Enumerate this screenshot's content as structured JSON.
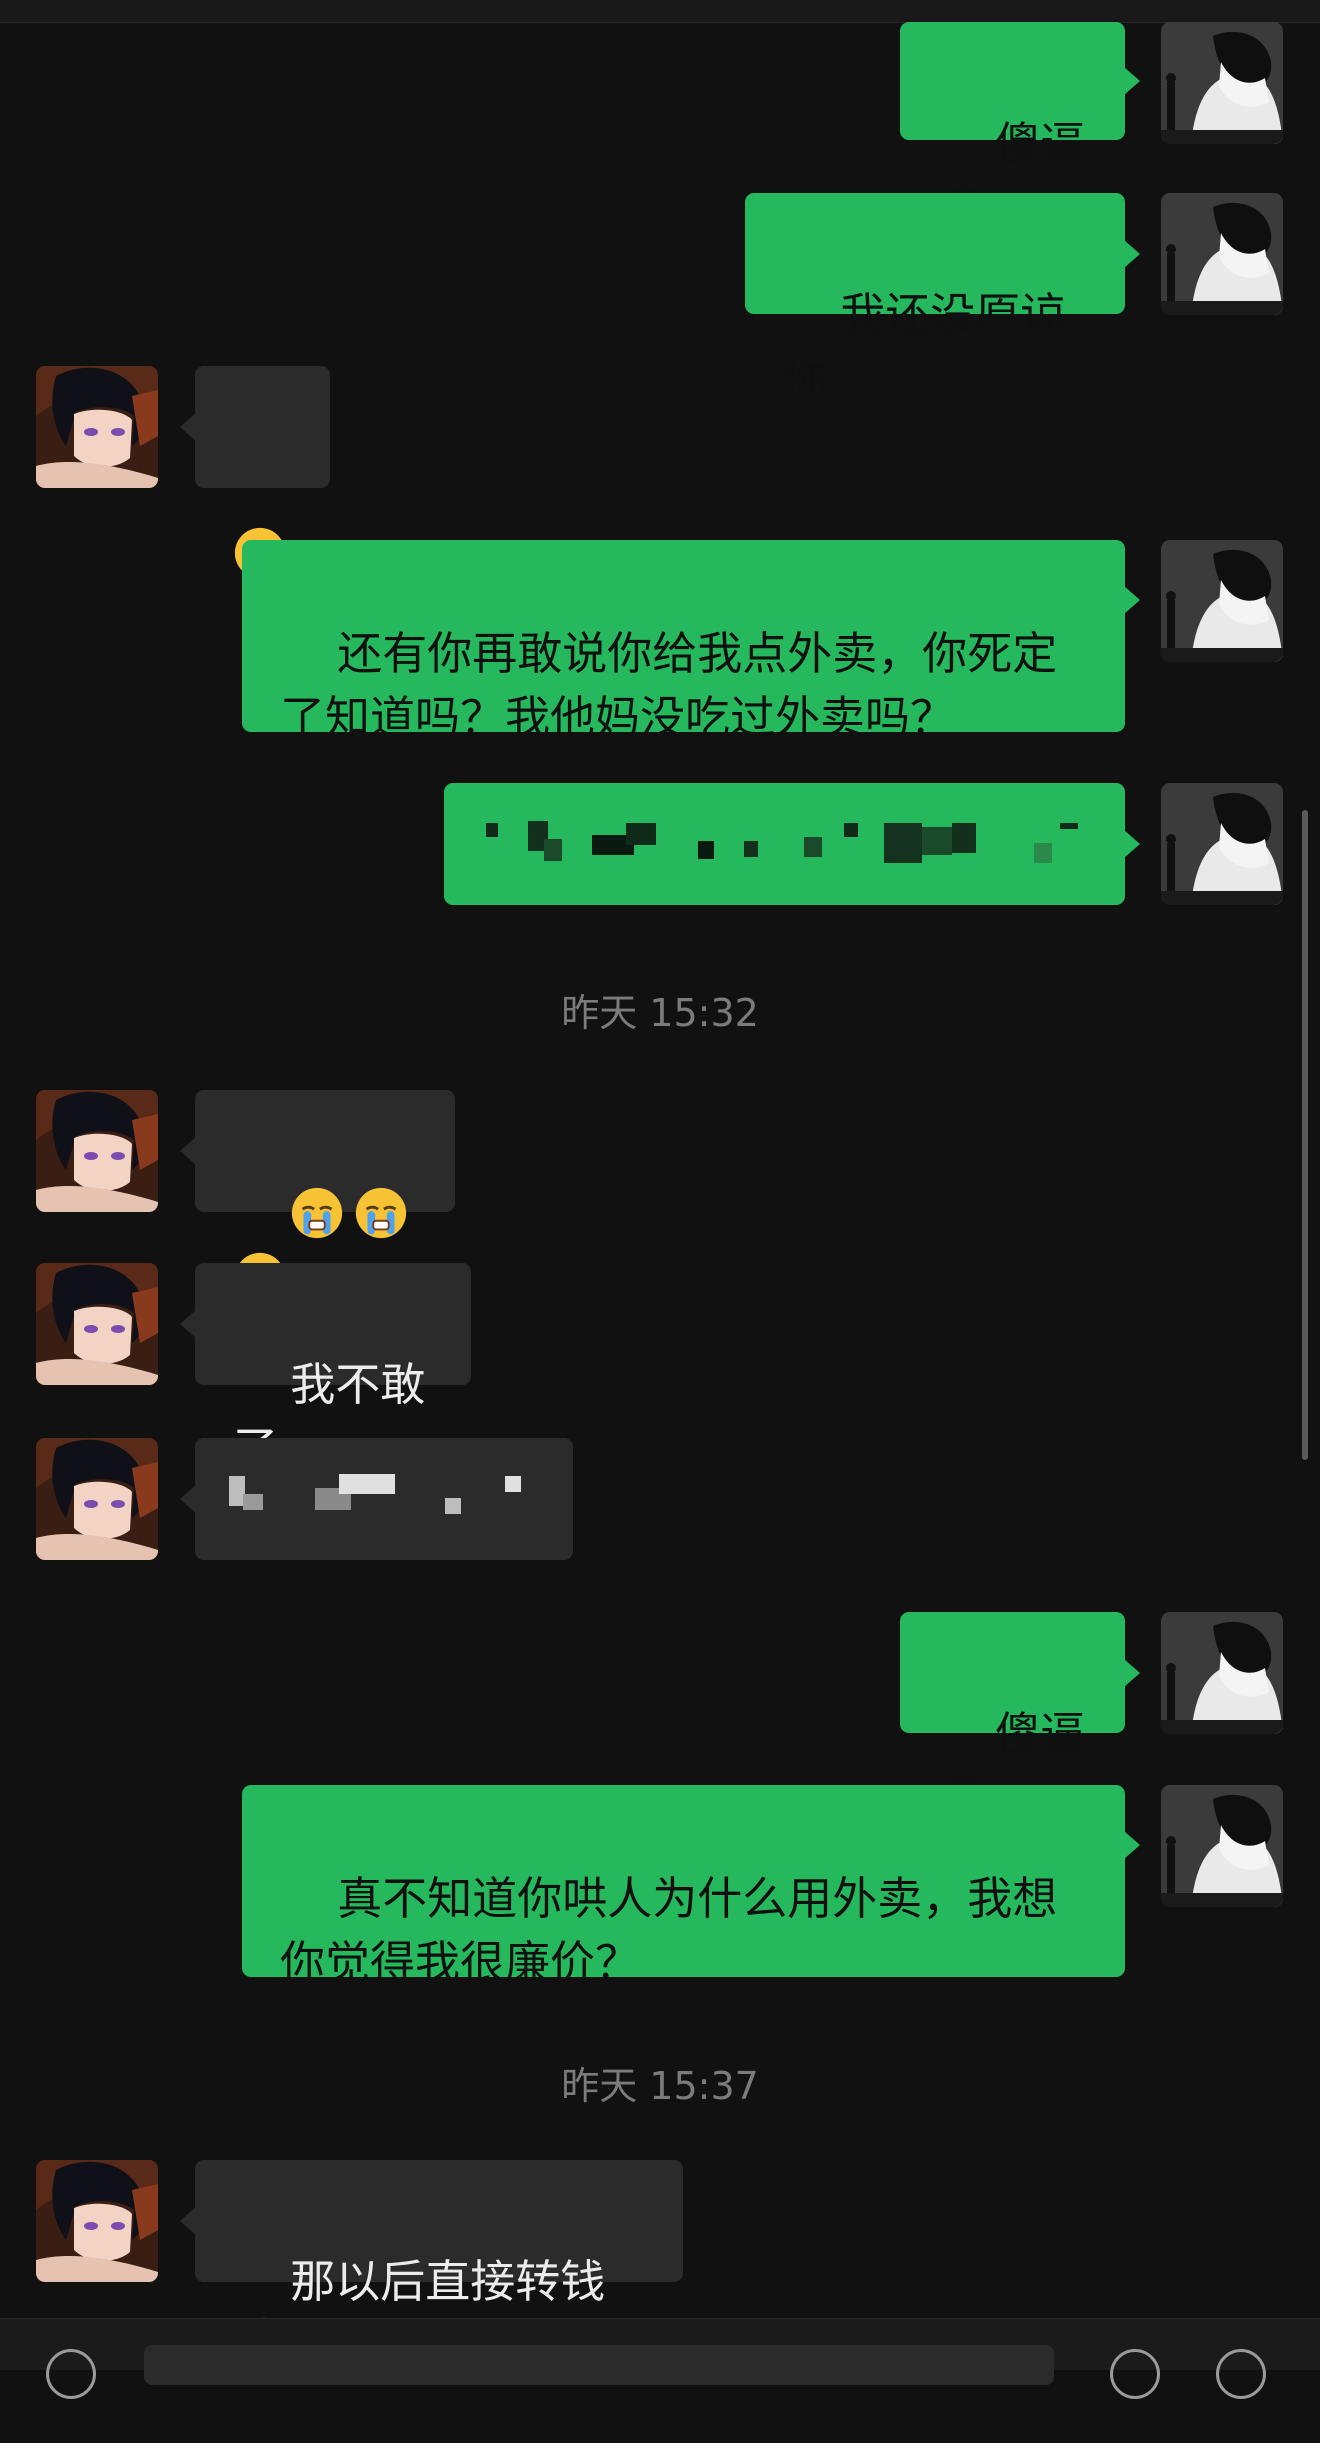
{
  "conversation": {
    "messages": [
      {
        "text": "傻逼滚"
      },
      {
        "text": "我还没原谅你"
      },
      {
        "text": "还有你再敢说你给我点外卖，你死定了知道吗？我他妈没吃过外卖吗？"
      },
      {
        "text": "我不敢了"
      },
      {
        "text": "傻逼滚"
      },
      {
        "text": "真不知道你哄人为什么用外卖，我想你觉得我很廉价？"
      },
      {
        "text": "那以后直接转钱"
      }
    ],
    "timestamps": [
      "昨天 15:32",
      "昨天 15:37"
    ]
  },
  "icons": {
    "emoji": "loudly-crying-face-emoji",
    "emoji_alt": "crying-face-emoji"
  },
  "colors": {
    "background": "#111111",
    "sent_bubble": "#25b85c",
    "received_bubble": "#2b2b2b",
    "timestamp_text": "#7b7b7b"
  }
}
